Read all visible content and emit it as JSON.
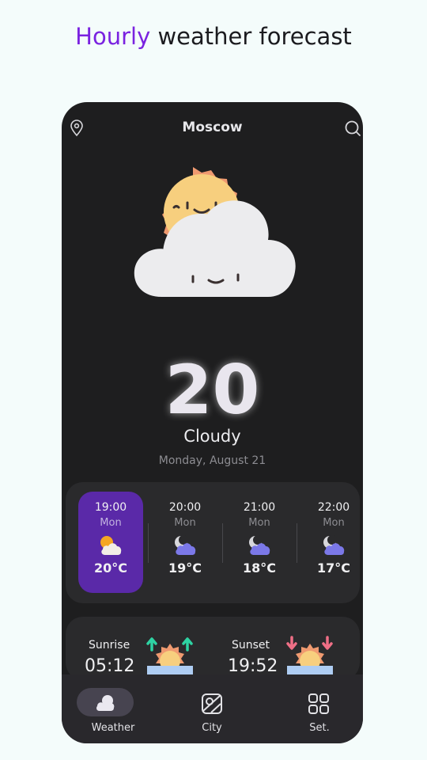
{
  "headline": {
    "accent": "Hourly",
    "rest": " weather forecast"
  },
  "app": {
    "city": "Moscow",
    "current": {
      "temp": "20",
      "condition": "Cloudy",
      "date": "Monday, August 21"
    },
    "hourly": [
      {
        "time": "19:00",
        "day": "Mon",
        "temp": "20°C",
        "icon": "partly-cloudy-sun-icon",
        "active": true
      },
      {
        "time": "20:00",
        "day": "Mon",
        "temp": "19°C",
        "icon": "cloudy-moon-icon",
        "active": false
      },
      {
        "time": "21:00",
        "day": "Mon",
        "temp": "18°C",
        "icon": "cloudy-moon-icon",
        "active": false
      },
      {
        "time": "22:00",
        "day": "Mon",
        "temp": "17°C",
        "icon": "cloudy-moon-icon",
        "active": false
      }
    ],
    "sun": {
      "sunrise_label": "Sunrise",
      "sunrise_time": "05:12",
      "sunset_label": "Sunset",
      "sunset_time": "19:52"
    },
    "nav": [
      {
        "label": "Weather",
        "icon": "weather-icon",
        "active": true
      },
      {
        "label": "City",
        "icon": "map-icon",
        "active": false
      },
      {
        "label": "Set.",
        "icon": "grid-icon",
        "active": false
      }
    ]
  },
  "colors": {
    "accent": "#7a22e0",
    "active_card": "#5a29a8",
    "phone_bg": "#1e1e1f",
    "card_bg": "#2a2a2c"
  }
}
